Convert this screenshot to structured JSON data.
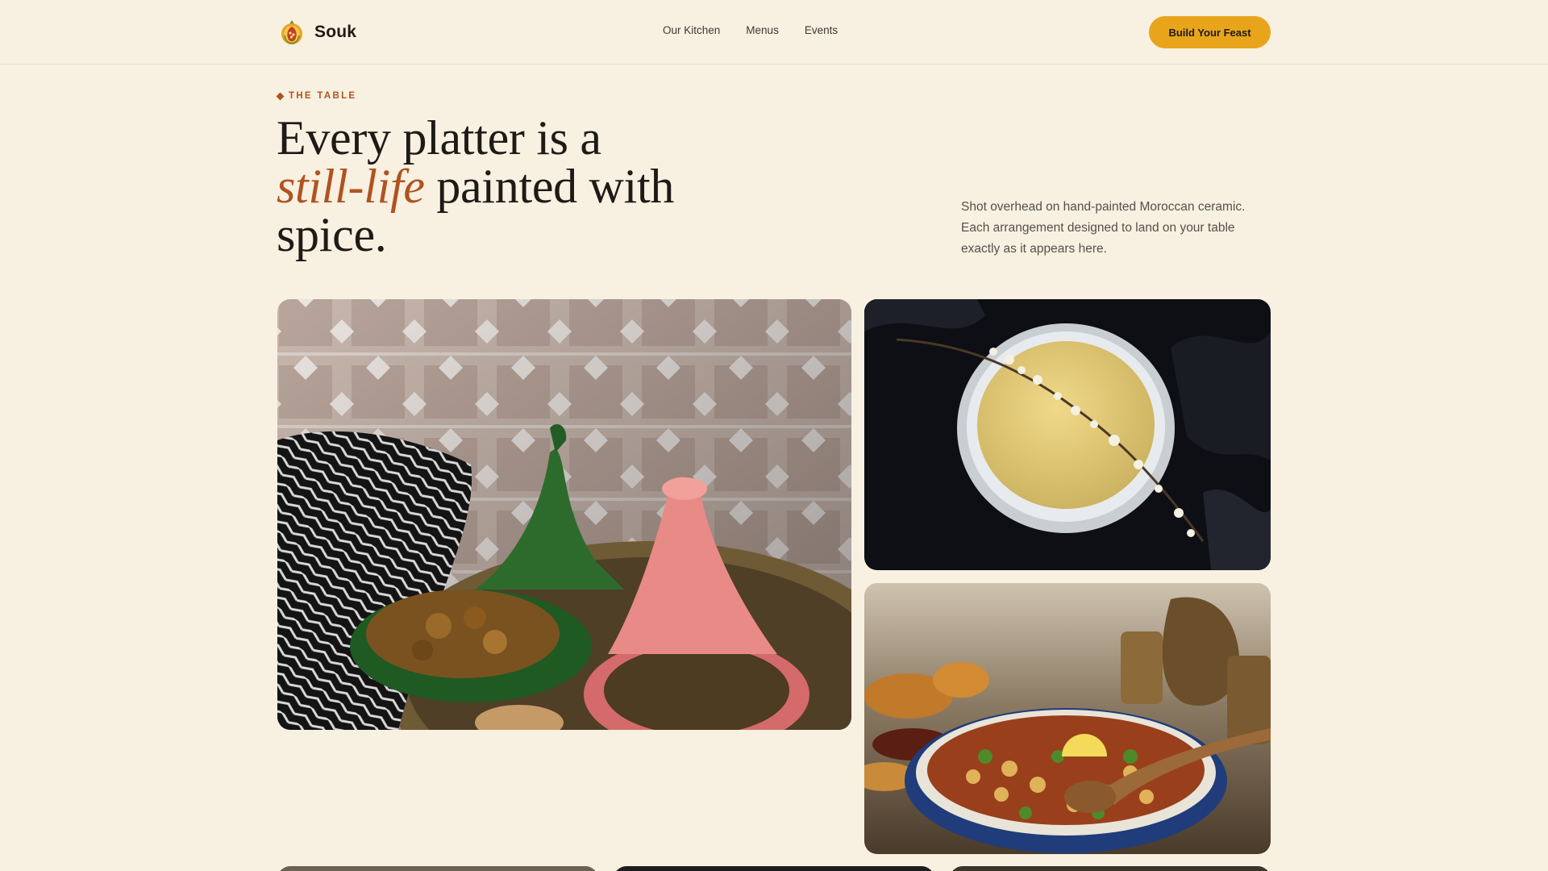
{
  "brand": {
    "name": "Souk",
    "logo_icon": "pomegranate-logo-icon"
  },
  "nav": {
    "links": [
      "Our Kitchen",
      "Menus",
      "Events"
    ]
  },
  "cta": {
    "label": "Build Your Feast"
  },
  "hero": {
    "eyebrow": "THE TABLE",
    "headline_1": "Every platter is a",
    "headline_accent": "still-life",
    "headline_2": " painted with",
    "headline_3": "spice.",
    "lede": "Shot overhead on hand-painted Moroccan ceramic. Each arrangement designed to land on your table exactly as it appears here."
  },
  "colors": {
    "background": "#f8f0e1",
    "accent": "#b0531f",
    "button": "#e8a51c",
    "text": "#1e1a16"
  }
}
